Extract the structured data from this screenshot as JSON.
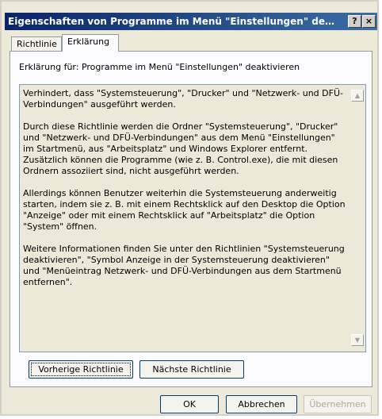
{
  "window": {
    "title": "Eigenschaften von Programme im Menü \"Einstellungen\" deakt...",
    "help_glyph": "?",
    "close_glyph": "×"
  },
  "tabs": [
    {
      "label": "Richtlinie",
      "active": false
    },
    {
      "label": "Erklärung",
      "active": true
    }
  ],
  "explanation": {
    "subtitle": "Erklärung für:  Programme im Menü \"Einstellungen\" deaktivieren",
    "paragraphs": [
      "Verhindert, dass \"Systemsteuerung\", \"Drucker\" und \"Netzwerk- und DFÜ-Verbindungen\" ausgeführt werden.",
      "Durch diese Richtlinie werden die Ordner \"Systemsteuerung\", \"Drucker\" und \"Netzwerk- und DFÜ-Verbindungen\" aus dem Menü \"Einstellungen\" im Startmenü, aus \"Arbeitsplatz\" und Windows Explorer entfernt. Zusätzlich können die Programme (wie z. B. Control.exe), die mit diesen Ordnern assoziiert sind, nicht ausgeführt werden.",
      "Allerdings können Benutzer weiterhin die Systemsteuerung anderweitig starten, indem sie z. B. mit einem Rechtsklick auf den Desktop die Option \"Anzeige\" oder mit einem Rechtsklick auf \"Arbeitsplatz\" die Option \"System\" öffnen.",
      "Weitere Informationen finden Sie unter den Richtlinien \"Systemsteuerung deaktivieren\", \"Symbol Anzeige in der Systemsteuerung deaktivieren\" und \"Menüeintrag Netzwerk- und DFÜ-Verbindungen aus dem Startmenü entfernen\"."
    ]
  },
  "scrollbar": {
    "up_glyph": "▲",
    "down_glyph": "▼"
  },
  "nav_buttons": {
    "previous": "Vorherige Richtlinie",
    "next": "Nächste Richtlinie"
  },
  "dialog_buttons": {
    "ok": "OK",
    "cancel": "Abbrechen",
    "apply": "Übernehmen",
    "apply_enabled": false
  }
}
